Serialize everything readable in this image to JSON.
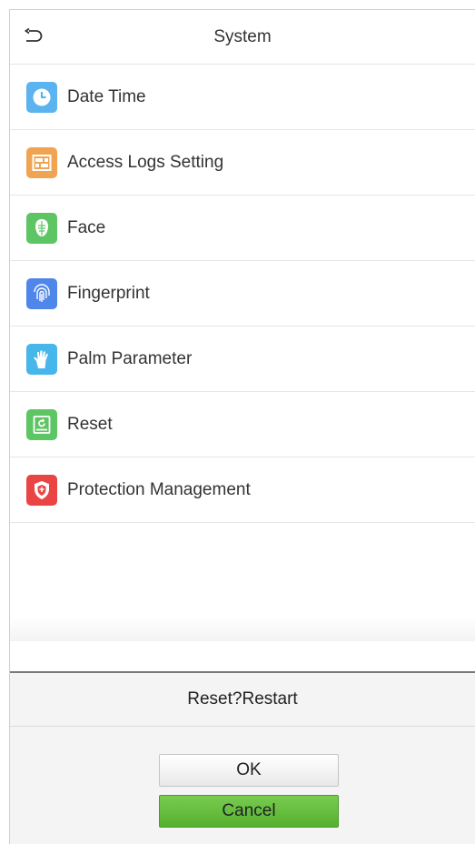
{
  "header": {
    "title": "System",
    "back_icon": "back-arrow-icon"
  },
  "menu": {
    "items": [
      {
        "label": "Date Time",
        "icon": "clock-icon",
        "color": "#5bb3ef"
      },
      {
        "label": "Access Logs Setting",
        "icon": "logs-icon",
        "color": "#f0a452"
      },
      {
        "label": "Face",
        "icon": "face-icon",
        "color": "#5dc563"
      },
      {
        "label": "Fingerprint",
        "icon": "fingerprint-icon",
        "color": "#4f86ea"
      },
      {
        "label": "Palm Parameter",
        "icon": "palm-icon",
        "color": "#47b6ea"
      },
      {
        "label": "Reset",
        "icon": "reset-icon",
        "color": "#5dc563"
      },
      {
        "label": "Protection Management",
        "icon": "shield-icon",
        "color": "#ea4545"
      }
    ]
  },
  "dialog": {
    "title": "Reset?Restart",
    "ok_label": "OK",
    "cancel_label": "Cancel",
    "cancel_color": "#62bb3b"
  }
}
